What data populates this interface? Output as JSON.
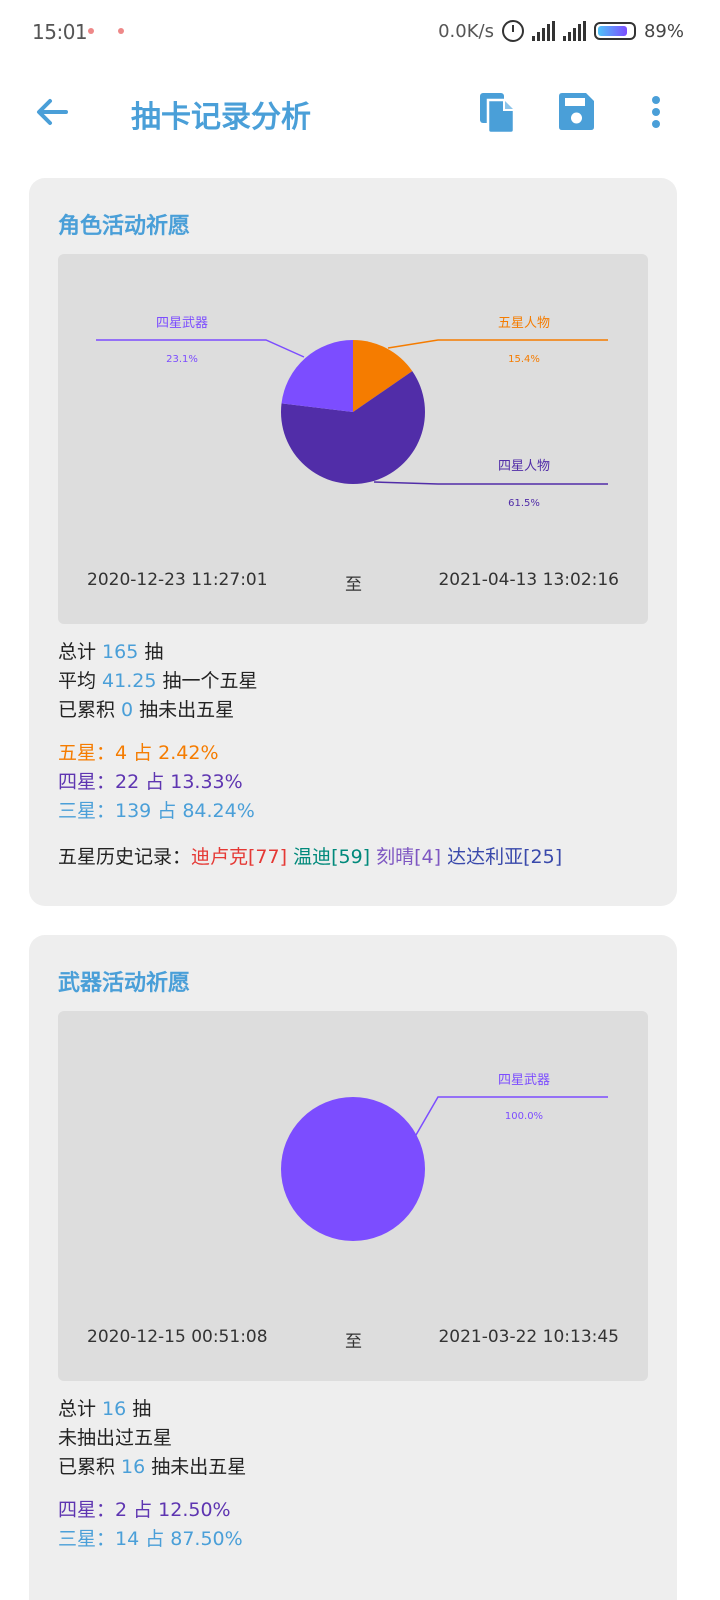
{
  "status_bar": {
    "time": "15:01",
    "net_speed": "0.0K/s",
    "battery": "89%"
  },
  "app_bar": {
    "title": "抽卡记录分析",
    "icons": [
      "back-arrow-icon",
      "copy-icon",
      "save-icon",
      "more-vert-icon"
    ]
  },
  "colors": {
    "accent": "#4a9fd8",
    "five_star": "#f57c00",
    "four_star_character": "#512da8",
    "four_star_weapon": "#7c4dff",
    "card_bg": "#eeeeee",
    "chart_bg": "#dddddd"
  },
  "character_pool": {
    "title": "角色活动祈愿",
    "date_start": "2020-12-23 11:27:01",
    "date_to": "至",
    "date_end": "2021-04-13 13:02:16",
    "total_prefix": "总计 ",
    "total": "165",
    "total_suffix": " 抽",
    "avg_prefix": "平均 ",
    "avg": "41.25",
    "avg_suffix": " 抽一个五星",
    "acc_prefix": "已累积 ",
    "acc": "0",
    "acc_suffix": " 抽未出五星",
    "five_star_line": "五星：4 占 2.42%",
    "four_star_line": "四星：22 占 13.33%",
    "three_star_line": "三星：139 占 84.24%",
    "history_label": "五星历史记录：",
    "history": [
      "迪卢克[77]",
      "温迪[59]",
      "刻晴[4]",
      "达达利亚[25]"
    ]
  },
  "weapon_pool": {
    "title": "武器活动祈愿",
    "date_start": "2020-12-15 00:51:08",
    "date_to": "至",
    "date_end": "2021-03-22 10:13:45",
    "total_prefix": "总计 ",
    "total": "16",
    "total_suffix": " 抽",
    "no_five": "未抽出过五星",
    "acc_prefix": "已累积 ",
    "acc": "16",
    "acc_suffix": " 抽未出五星",
    "four_star_line": "四星：2 占 12.50%",
    "three_star_line": "三星：14 占 87.50%"
  },
  "chart_data": [
    {
      "type": "pie",
      "title": "",
      "labels": [
        "五星人物",
        "四星人物",
        "四星武器"
      ],
      "values": [
        15.4,
        61.5,
        23.1
      ],
      "value_labels": [
        "15.4%",
        "61.5%",
        "23.1%"
      ],
      "colors": [
        "#f57c00",
        "#512da8",
        "#7c4dff"
      ]
    },
    {
      "type": "pie",
      "title": "",
      "labels": [
        "四星武器"
      ],
      "values": [
        100.0
      ],
      "value_labels": [
        "100.0%"
      ],
      "colors": [
        "#7c4dff"
      ]
    }
  ]
}
